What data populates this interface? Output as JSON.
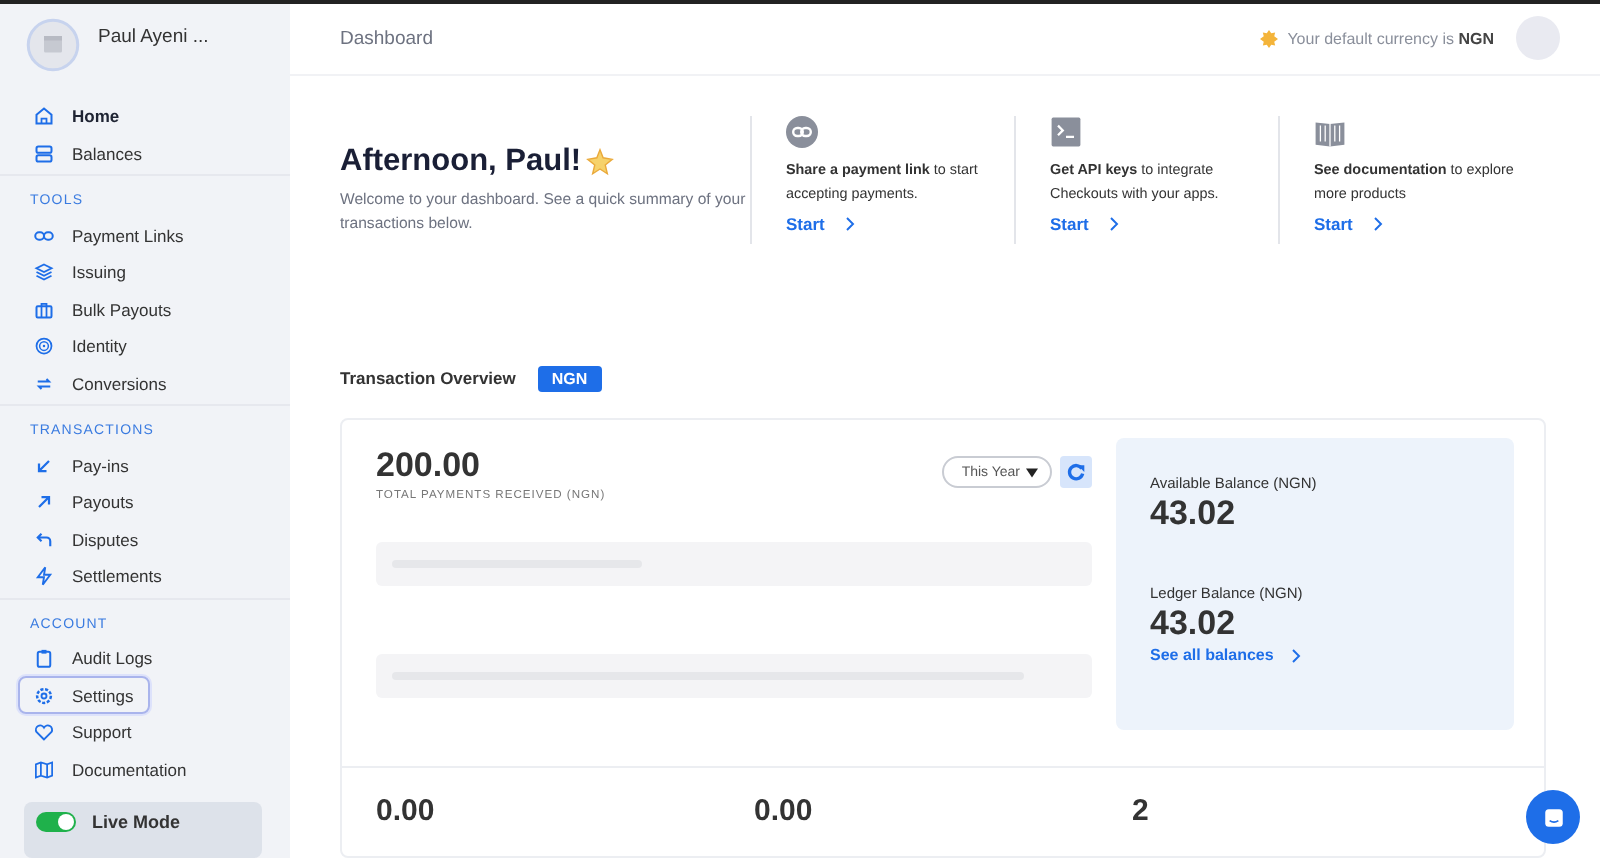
{
  "sidebar": {
    "account_name": "Paul Ayeni ...",
    "sections": [
      {
        "items": [
          {
            "label": "Home",
            "selected": true,
            "focused": false
          },
          {
            "label": "Balances",
            "selected": false,
            "focused": false
          }
        ]
      },
      {
        "heading": "TOOLS",
        "items": [
          {
            "label": "Payment Links",
            "selected": false,
            "focused": false
          },
          {
            "label": "Issuing",
            "selected": false,
            "focused": false
          },
          {
            "label": "Bulk Payouts",
            "selected": false,
            "focused": false
          },
          {
            "label": "Identity",
            "selected": false,
            "focused": false
          },
          {
            "label": "Conversions",
            "selected": false,
            "focused": false
          }
        ]
      },
      {
        "heading": "TRANSACTIONS",
        "items": [
          {
            "label": "Pay-ins",
            "selected": false,
            "focused": false
          },
          {
            "label": "Payouts",
            "selected": false,
            "focused": false
          },
          {
            "label": "Disputes",
            "selected": false,
            "focused": false
          },
          {
            "label": "Settlements",
            "selected": false,
            "focused": false
          }
        ]
      },
      {
        "heading": "ACCOUNT",
        "items": [
          {
            "label": "Audit Logs",
            "selected": false,
            "focused": false
          },
          {
            "label": "Settings",
            "selected": false,
            "focused": true
          },
          {
            "label": "Support",
            "selected": false,
            "focused": false
          },
          {
            "label": "Documentation",
            "selected": false,
            "focused": false
          }
        ]
      }
    ],
    "mode_toggle": {
      "label": "Live Mode",
      "on": true
    }
  },
  "header": {
    "title": "Dashboard",
    "currency_note": "Your default currency is **NGN**"
  },
  "greeting": {
    "title": "Afternoon, Paul!",
    "subtitle": "Welcome to your dashboard. See a quick summary of your transactions below."
  },
  "quick_actions": [
    {
      "text": "**Share a payment link** to start accepting payments.",
      "link": "Start"
    },
    {
      "text": "**Get API keys** to integrate Checkouts with your apps.",
      "link": "Start"
    },
    {
      "text": "**See documentation** to explore more products",
      "link": "Start"
    }
  ],
  "overview": {
    "title": "Transaction Overview",
    "currency": "NGN",
    "total": "200.00",
    "total_label": "TOTAL PAYMENTS RECEIVED (NGN)",
    "period": "This Year",
    "balances": [
      {
        "label": "Available Balance (NGN)",
        "value": "43.02"
      },
      {
        "label": "Ledger Balance (NGN)",
        "value": "43.02"
      }
    ],
    "balances_link": "See all balances",
    "stats": [
      "0.00",
      "0.00",
      "2"
    ]
  }
}
